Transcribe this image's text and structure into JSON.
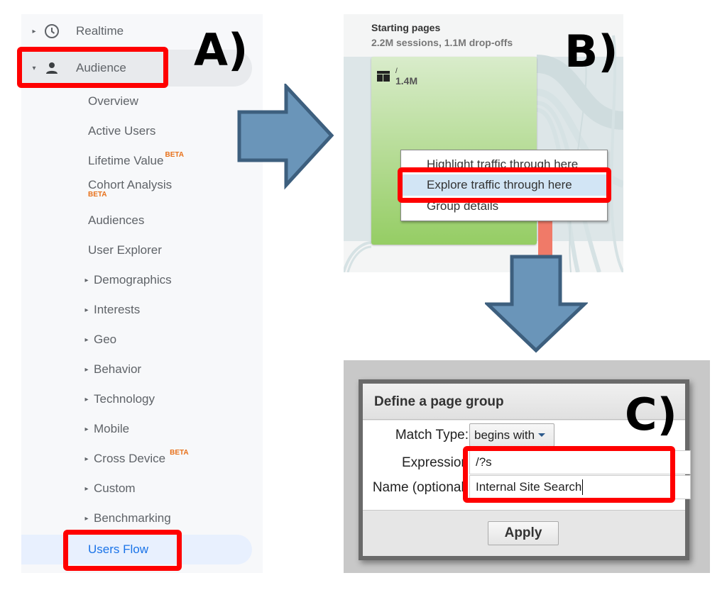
{
  "annotations": {
    "panel_a_label": "A)",
    "panel_b_label": "B)",
    "panel_c_label": "C)",
    "arrow_color": "#6a95b9",
    "arrow_border_color": "#3d5f7e",
    "highlight_color": "#ff0000"
  },
  "sidebar": {
    "realtime": {
      "label": "Realtime",
      "icon": "clock-icon"
    },
    "audience": {
      "label": "Audience",
      "icon": "person-icon",
      "expanded": true
    },
    "items": [
      {
        "label": "Overview"
      },
      {
        "label": "Active Users"
      },
      {
        "label": "Lifetime Value",
        "badge": "BETA"
      },
      {
        "label": "Cohort Analysis",
        "badge": "BETA"
      },
      {
        "label": "Audiences"
      },
      {
        "label": "User Explorer"
      },
      {
        "label": "Demographics",
        "expandable": true
      },
      {
        "label": "Interests",
        "expandable": true
      },
      {
        "label": "Geo",
        "expandable": true
      },
      {
        "label": "Behavior",
        "expandable": true
      },
      {
        "label": "Technology",
        "expandable": true
      },
      {
        "label": "Mobile",
        "expandable": true
      },
      {
        "label": "Cross Device",
        "expandable": true,
        "badge": "BETA"
      },
      {
        "label": "Custom",
        "expandable": true
      },
      {
        "label": "Benchmarking",
        "expandable": true
      },
      {
        "label": "Users Flow",
        "selected": true
      }
    ]
  },
  "flow": {
    "column_title": "Starting pages",
    "column_summary": "2.2M sessions, 1.1M drop-offs",
    "node": {
      "path": "/",
      "value": "1.4M",
      "icon": "page-layout-icon"
    },
    "context_menu": [
      {
        "label": "Highlight traffic through here"
      },
      {
        "label": "Explore traffic through here",
        "active": true
      },
      {
        "label": "Group details"
      }
    ]
  },
  "dialog": {
    "title": "Define a page group",
    "match_type_label": "Match Type:",
    "match_type_value": "begins with",
    "expression_label": "Expression",
    "expression_value": "/?s",
    "name_label": "Name (optional)",
    "name_value": "Internal Site Search",
    "apply_label": "Apply"
  }
}
